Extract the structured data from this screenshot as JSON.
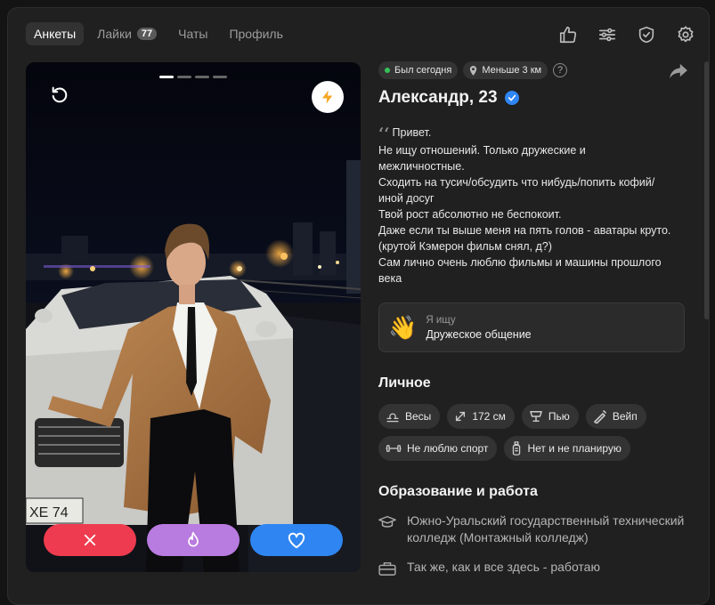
{
  "nav": {
    "tabs": [
      {
        "label": "Анкеты",
        "active": true
      },
      {
        "label": "Лайки",
        "badge": "77"
      },
      {
        "label": "Чаты"
      },
      {
        "label": "Профиль"
      }
    ],
    "icons": [
      "thumbs-up-icon",
      "sliders-icon",
      "shield-icon",
      "gear-icon"
    ]
  },
  "photo": {
    "plate_text": "ХЕ 74",
    "page_count": 4,
    "current_page": 1
  },
  "profile": {
    "status": "Был сегодня",
    "distance": "Меньше 3 км",
    "help": "?",
    "name": "Александр, 23",
    "bio_lines": [
      "Привет.",
      "Не ищу отношений. Только дружеские и",
      "межличностные.",
      "Сходить на тусич/обсудить что нибудь/попить кофий/",
      "иной досуг",
      "Твой рост абсолютно не беспокоит.",
      "Даже если ты выше меня на пять голов - аватары круто.",
      "(крутой Кэмерон фильм снял, д?)",
      "Сам лично очень люблю фильмы и машины прошлого",
      "века"
    ],
    "seeking": {
      "label": "Я ищу",
      "value": "Дружеское общение"
    }
  },
  "personal": {
    "title": "Личное",
    "tags_row1": [
      {
        "icon": "libra-icon",
        "label": "Весы"
      },
      {
        "icon": "height-icon",
        "label": "172 см"
      },
      {
        "icon": "glass-icon",
        "label": "Пью"
      },
      {
        "icon": "vape-icon",
        "label": "Вейп"
      }
    ],
    "tags_row2": [
      {
        "icon": "dumbbell-icon",
        "label": "Не люблю спорт"
      },
      {
        "icon": "baby-bottle-icon",
        "label": "Нет и не планирую"
      }
    ]
  },
  "work": {
    "title": "Образование и работа",
    "education": "Южно-Уральский государственный технический колледж (Монтажный колледж)",
    "job": "Так же, как и все здесь - работаю"
  },
  "colors": {
    "dislike": "#ef3b4f",
    "superlike": "#b87be0",
    "like": "#2f86f2",
    "verified": "#2f86f2",
    "online": "#36c25a"
  }
}
